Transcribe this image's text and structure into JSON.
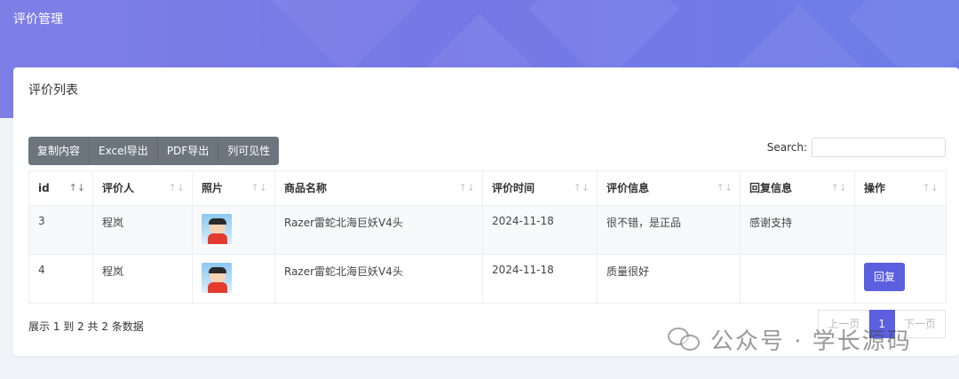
{
  "header": {
    "title": "评价管理"
  },
  "card": {
    "title": "评价列表"
  },
  "toolbar": {
    "buttons": [
      "复制内容",
      "Excel导出",
      "PDF导出",
      "列可见性"
    ]
  },
  "search": {
    "label": "Search:",
    "value": "",
    "placeholder": ""
  },
  "table": {
    "columns": [
      "id",
      "评价人",
      "照片",
      "商品名称",
      "评价时间",
      "评价信息",
      "回复信息",
      "操作"
    ],
    "rows": [
      {
        "id": "3",
        "reviewer": "程岚",
        "product": "Razer雷蛇北海巨妖V4头",
        "time": "2024-11-18",
        "review": "很不错，是正品",
        "reply": "感谢支持",
        "action": ""
      },
      {
        "id": "4",
        "reviewer": "程岚",
        "product": "Razer雷蛇北海巨妖V4头",
        "time": "2024-11-18",
        "review": "质量很好",
        "reply": "",
        "action": "回复"
      }
    ]
  },
  "footer": {
    "info": "展示 1 到 2 共 2 条数据"
  },
  "pagination": {
    "prev": "上一页",
    "current": "1",
    "next": "下一页"
  },
  "watermark": {
    "text": "公众号 · 学长源码"
  },
  "colors": {
    "accent": "#5b5fe0",
    "header": "#7578e6",
    "toolbar": "#6c757d"
  }
}
